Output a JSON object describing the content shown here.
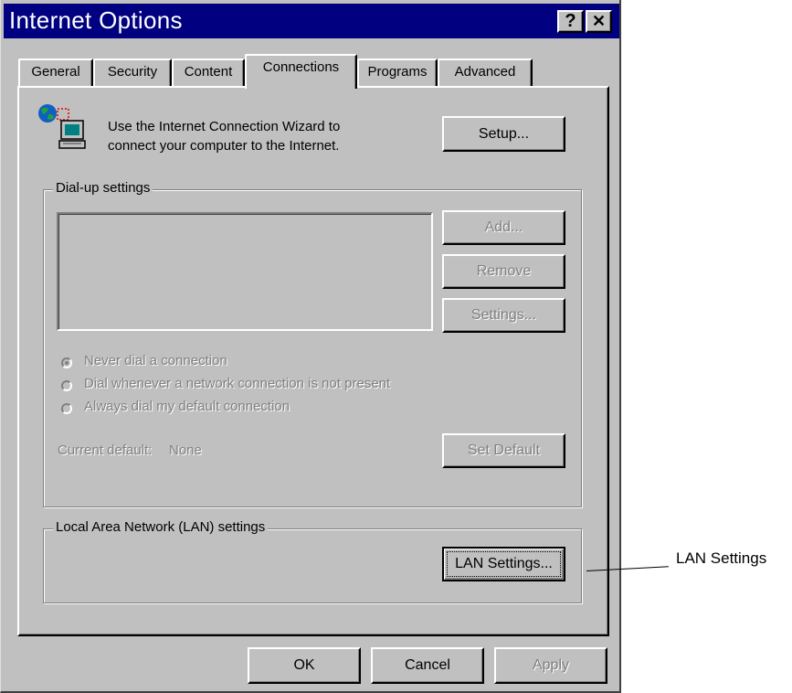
{
  "window": {
    "title": "Internet Options",
    "help_button": "?",
    "close_button": "✕"
  },
  "tabs": [
    {
      "label": "General"
    },
    {
      "label": "Security"
    },
    {
      "label": "Content"
    },
    {
      "label": "Connections",
      "active": true
    },
    {
      "label": "Programs"
    },
    {
      "label": "Advanced"
    }
  ],
  "wizard": {
    "icon": "network-computer-globe-icon",
    "line1": "Use the Internet Connection Wizard to",
    "line2": "connect your computer to the Internet.",
    "setup_button": "Setup..."
  },
  "dialup": {
    "group_label": "Dial-up settings",
    "add_button": "Add...",
    "remove_button": "Remove",
    "settings_button": "Settings...",
    "radio_options": [
      {
        "label": "Never dial a connection",
        "checked": true
      },
      {
        "label": "Dial whenever a network connection is not present",
        "checked": false
      },
      {
        "label": "Always dial my default connection",
        "checked": false
      }
    ],
    "current_default_label": "Current default:",
    "current_default_value": "None",
    "set_default_button": "Set Default"
  },
  "lan": {
    "group_label": "Local Area Network (LAN) settings",
    "lan_settings_button": "LAN Settings..."
  },
  "footer": {
    "ok_button": "OK",
    "cancel_button": "Cancel",
    "apply_button": "Apply"
  },
  "annotation": {
    "text": "LAN Settings"
  },
  "colors": {
    "titlebar": "#000080",
    "face": "#c0c0c0",
    "disabled_text": "#808080"
  }
}
